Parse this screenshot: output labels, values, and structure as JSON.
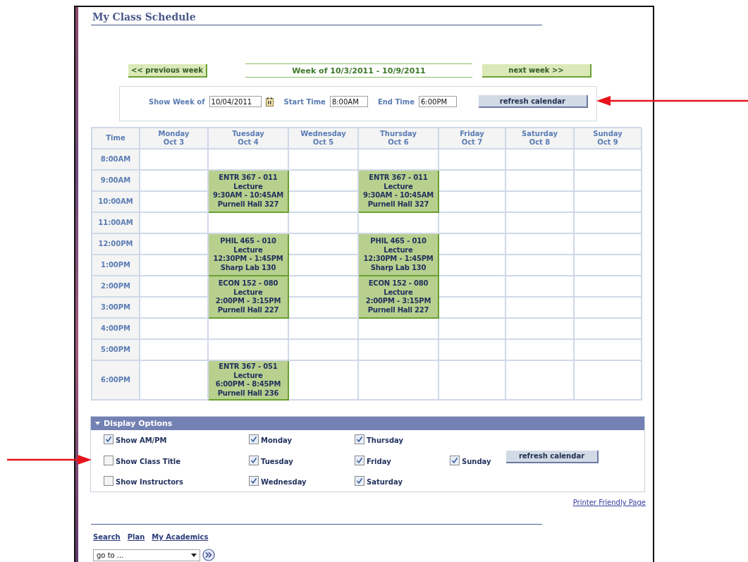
{
  "page_title": "My Class Schedule",
  "week_nav": {
    "previous": "<< previous week",
    "label": "Week of 10/3/2011 - 10/9/2011",
    "next": "next week >>"
  },
  "filters": {
    "fields": [
      {
        "label": "Show Week of",
        "value": "10/04/2011",
        "kind": "date"
      },
      {
        "label": "Start Time",
        "value": "8:00AM",
        "kind": "time"
      },
      {
        "label": "End Time",
        "value": "6:00PM",
        "kind": "time"
      }
    ],
    "button": "refresh calendar"
  },
  "schedule": {
    "time_heading": "Time",
    "days": [
      {
        "day": "Monday",
        "date": "Oct 3"
      },
      {
        "day": "Tuesday",
        "date": "Oct 4"
      },
      {
        "day": "Wednesday",
        "date": "Oct 5"
      },
      {
        "day": "Thursday",
        "date": "Oct 6"
      },
      {
        "day": "Friday",
        "date": "Oct 7"
      },
      {
        "day": "Saturday",
        "date": "Oct 8"
      },
      {
        "day": "Sunday",
        "date": "Oct 9"
      }
    ],
    "rows": [
      {
        "time": "8:00AM",
        "cells": [
          {
            "kind": "empty"
          },
          {
            "kind": "empty"
          },
          {
            "kind": "empty"
          },
          {
            "kind": "empty"
          },
          {
            "kind": "empty"
          },
          {
            "kind": "empty"
          },
          {
            "kind": "empty"
          }
        ]
      },
      {
        "time": "9:00AM",
        "cells": [
          {
            "kind": "empty"
          },
          {
            "kind": "event",
            "lines": [
              "ENTR 367 - 011",
              "Lecture",
              "9:30AM - 10:45AM",
              "Purnell Hall 327"
            ]
          },
          {
            "kind": "empty"
          },
          {
            "kind": "event",
            "lines": [
              "ENTR 367 - 011",
              "Lecture",
              "9:30AM - 10:45AM",
              "Purnell Hall 327"
            ]
          },
          {
            "kind": "empty"
          },
          {
            "kind": "empty"
          },
          {
            "kind": "empty"
          }
        ]
      },
      {
        "time": "10:00AM",
        "cells": [
          {
            "kind": "empty"
          },
          {
            "kind": "covered"
          },
          {
            "kind": "empty"
          },
          {
            "kind": "covered"
          },
          {
            "kind": "empty"
          },
          {
            "kind": "empty"
          },
          {
            "kind": "empty"
          }
        ]
      },
      {
        "time": "11:00AM",
        "cells": [
          {
            "kind": "empty"
          },
          {
            "kind": "empty"
          },
          {
            "kind": "empty"
          },
          {
            "kind": "empty"
          },
          {
            "kind": "empty"
          },
          {
            "kind": "empty"
          },
          {
            "kind": "empty"
          }
        ]
      },
      {
        "time": "12:00PM",
        "cells": [
          {
            "kind": "empty"
          },
          {
            "kind": "event",
            "lines": [
              "PHIL 465 - 010",
              "Lecture",
              "12:30PM - 1:45PM",
              "Sharp Lab 130"
            ]
          },
          {
            "kind": "empty"
          },
          {
            "kind": "event",
            "lines": [
              "PHIL 465 - 010",
              "Lecture",
              "12:30PM - 1:45PM",
              "Sharp Lab 130"
            ]
          },
          {
            "kind": "empty"
          },
          {
            "kind": "empty"
          },
          {
            "kind": "empty"
          }
        ]
      },
      {
        "time": "1:00PM",
        "cells": [
          {
            "kind": "empty"
          },
          {
            "kind": "covered"
          },
          {
            "kind": "empty"
          },
          {
            "kind": "covered"
          },
          {
            "kind": "empty"
          },
          {
            "kind": "empty"
          },
          {
            "kind": "empty"
          }
        ]
      },
      {
        "time": "2:00PM",
        "cells": [
          {
            "kind": "empty"
          },
          {
            "kind": "event",
            "lines": [
              "ECON 152 - 080",
              "Lecture",
              "2:00PM - 3:15PM",
              "Purnell Hall 227"
            ]
          },
          {
            "kind": "empty"
          },
          {
            "kind": "event",
            "lines": [
              "ECON 152 - 080",
              "Lecture",
              "2:00PM - 3:15PM",
              "Purnell Hall 227"
            ]
          },
          {
            "kind": "empty"
          },
          {
            "kind": "empty"
          },
          {
            "kind": "empty"
          }
        ]
      },
      {
        "time": "3:00PM",
        "cells": [
          {
            "kind": "empty"
          },
          {
            "kind": "covered"
          },
          {
            "kind": "empty"
          },
          {
            "kind": "covered"
          },
          {
            "kind": "empty"
          },
          {
            "kind": "empty"
          },
          {
            "kind": "empty"
          }
        ]
      },
      {
        "time": "4:00PM",
        "cells": [
          {
            "kind": "empty"
          },
          {
            "kind": "empty"
          },
          {
            "kind": "empty"
          },
          {
            "kind": "empty"
          },
          {
            "kind": "empty"
          },
          {
            "kind": "empty"
          },
          {
            "kind": "empty"
          }
        ]
      },
      {
        "time": "5:00PM",
        "cells": [
          {
            "kind": "empty"
          },
          {
            "kind": "empty"
          },
          {
            "kind": "empty"
          },
          {
            "kind": "empty"
          },
          {
            "kind": "empty"
          },
          {
            "kind": "empty"
          },
          {
            "kind": "empty"
          }
        ]
      },
      {
        "time": "6:00PM",
        "cells": [
          {
            "kind": "empty"
          },
          {
            "kind": "event",
            "lines": [
              "ENTR 367 - 051",
              "Lecture",
              "6:00PM - 8:45PM",
              "Purnell Hall 236"
            ]
          },
          {
            "kind": "empty"
          },
          {
            "kind": "empty"
          },
          {
            "kind": "empty"
          },
          {
            "kind": "empty"
          },
          {
            "kind": "empty"
          }
        ]
      }
    ]
  },
  "display_options": {
    "title": "Display Options",
    "expanded": true,
    "columns": [
      [
        {
          "label": "Show AM/PM",
          "checked": true
        },
        {
          "label": "Show Class Title",
          "checked": false
        },
        {
          "label": "Show Instructors",
          "checked": false
        }
      ],
      [
        {
          "label": "Monday",
          "checked": true
        },
        {
          "label": "Tuesday",
          "checked": true
        },
        {
          "label": "Wednesday",
          "checked": true
        }
      ],
      [
        {
          "label": "Thursday",
          "checked": true
        },
        {
          "label": "Friday",
          "checked": true
        },
        {
          "label": "Saturday",
          "checked": true
        }
      ],
      [
        {
          "label": "Sunday",
          "checked": true
        }
      ]
    ],
    "button": "refresh calendar"
  },
  "printer_link": "Printer Friendly Page",
  "footer_links": [
    "Search",
    "Plan",
    "My Academics"
  ],
  "goto": {
    "value": "go to ..."
  }
}
